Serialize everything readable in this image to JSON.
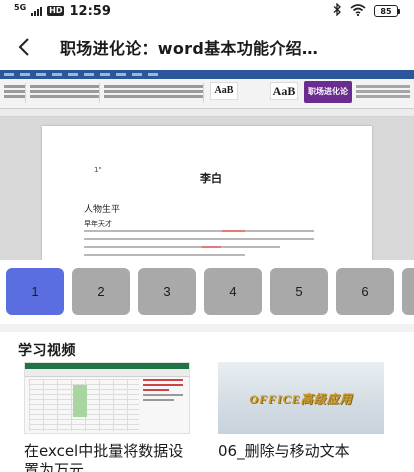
{
  "status_bar": {
    "network": "5G",
    "hd": "HD",
    "time": "12:59",
    "battery": "85",
    "icons": [
      "bluetooth-icon",
      "wifi-icon",
      "battery-icon"
    ]
  },
  "header": {
    "back_icon": "chevron-left-icon",
    "title": "职场进化论：word基本功能介绍…"
  },
  "video": {
    "doc_title": "李白",
    "doc_heading": "人物生平",
    "doc_subheading": "早年天才",
    "ribbon_style_sample": "AaB",
    "logo_text": "职场进化论"
  },
  "pages": {
    "items": [
      "1",
      "2",
      "3",
      "4",
      "5",
      "6"
    ],
    "active": "1"
  },
  "learning_videos": {
    "title": "学习视频",
    "items": [
      {
        "title": "在excel中批量将数据设置为万元…"
      },
      {
        "title": "06_删除与移动文本",
        "thumb_title": "OFFICE高级应用"
      }
    ]
  }
}
